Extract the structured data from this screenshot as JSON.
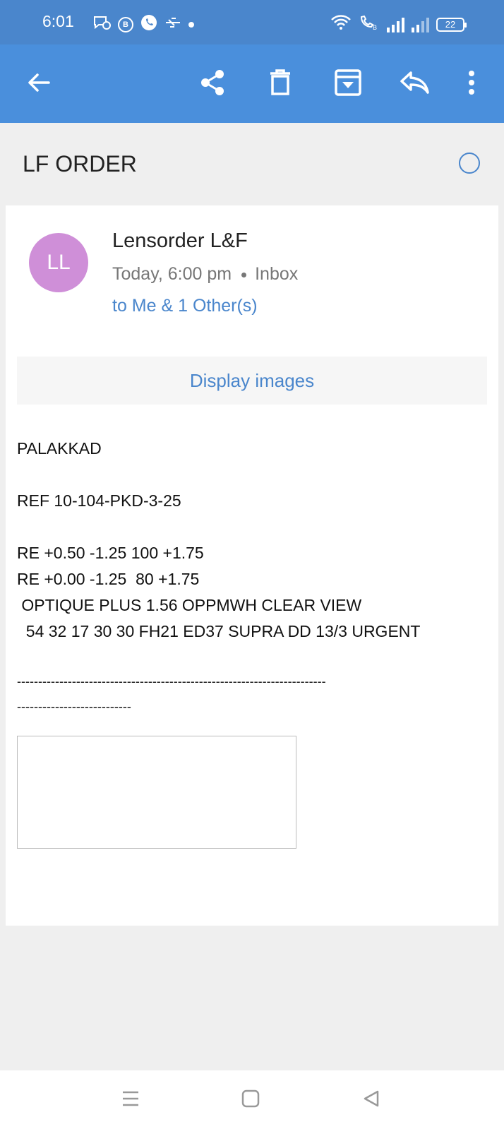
{
  "status_bar": {
    "time": "6:01",
    "battery": "22",
    "icons": [
      "chat-icon",
      "b-icon",
      "phone-icon",
      "usb-icon",
      "dot-icon",
      "wifi-icon",
      "volte-icon",
      "signal-icon",
      "signal-icon",
      "battery-icon"
    ]
  },
  "toolbar": {
    "icons": [
      "back-arrow-icon",
      "share-icon",
      "trash-icon",
      "archive-icon",
      "reply-icon",
      "more-vert-icon"
    ],
    "color": "#4a8fdc"
  },
  "email": {
    "subject": "LF ORDER",
    "avatar_initials": "LL",
    "avatar_color": "#cf8fd8",
    "sender": "Lensorder L&F",
    "time": "Today, 6:00 pm",
    "folder": "Inbox",
    "recipients": "to Me & 1 Other(s)",
    "display_images": "Display images",
    "body": {
      "line1": "PALAKKAD",
      "line2": "REF 10-104-PKD-3-25",
      "line3": "RE +0.50 -1.25 100 +1.75",
      "line4": "RE +0.00 -1.25  80 +1.75",
      "line5": " OPTIQUE PLUS 1.56 OPPMWH CLEAR VIEW",
      "line6": "  54 32 17 30 30 FH21 ED37 SUPRA DD 13/3 URGENT",
      "divider1": "-------------------------------------------------------------------------",
      "divider2": "---------------------------"
    }
  },
  "nav_bar": {
    "icons": [
      "recents-icon",
      "home-icon",
      "back-icon"
    ]
  }
}
